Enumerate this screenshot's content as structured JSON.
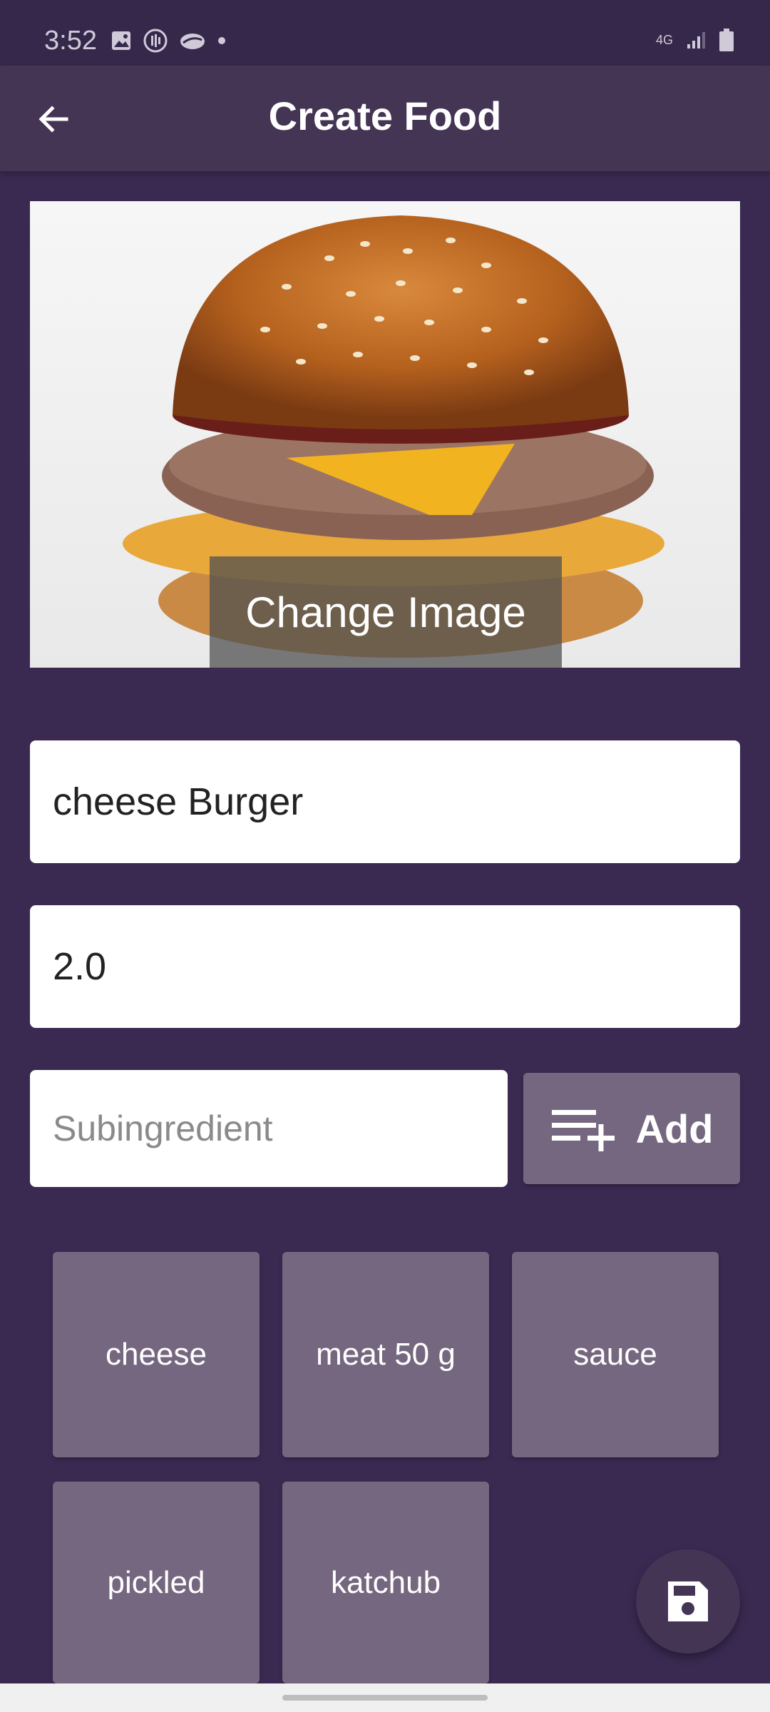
{
  "status_bar": {
    "time": "3:52",
    "network": "4G"
  },
  "app_bar": {
    "title": "Create Food",
    "back_icon": "arrow-back-icon"
  },
  "image_section": {
    "change_image_label": "Change Image"
  },
  "form": {
    "name_value": "cheese Burger",
    "price_value": "2.0",
    "subingredient_placeholder": "Subingredient",
    "add_button_label": "Add"
  },
  "subingredients": [
    {
      "label": "cheese"
    },
    {
      "label": "meat 50 g"
    },
    {
      "label": "sauce"
    },
    {
      "label": "pickled"
    },
    {
      "label": "katchub"
    }
  ],
  "fab": {
    "icon": "save-icon"
  },
  "colors": {
    "background": "#3a2a52",
    "app_bar": "#453555",
    "chip": "#75677f"
  }
}
